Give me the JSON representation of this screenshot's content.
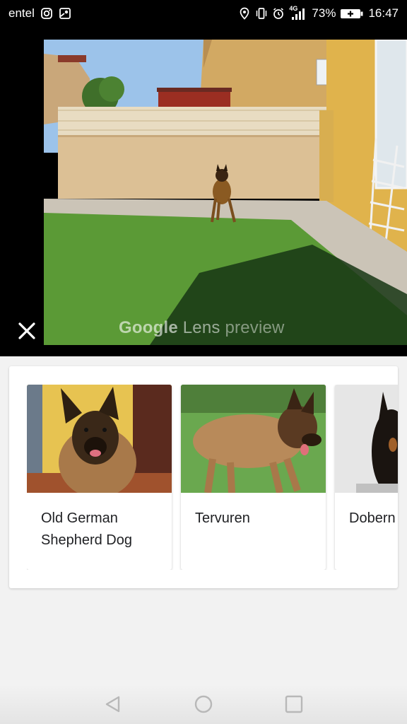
{
  "status_bar": {
    "carrier": "entel",
    "network": "4G",
    "battery_percent": "73%",
    "time": "16:47",
    "icons": [
      "instagram-icon",
      "maps-icon",
      "location-icon",
      "vibrate-icon",
      "alarm-icon",
      "signal-icon",
      "battery-icon"
    ]
  },
  "preview": {
    "brand": "Google",
    "lens_word": "Lens",
    "preview_word": "preview",
    "close_icon": "close-icon"
  },
  "results": [
    {
      "name": "Old German Shepherd Dog"
    },
    {
      "name": "Tervuren"
    },
    {
      "name": "Dobern"
    }
  ],
  "nav": {
    "back": "back-icon",
    "home": "home-icon",
    "recents": "recents-icon"
  },
  "colors": {
    "status_bar_bg": "#000000",
    "page_bg": "#f2f2f2",
    "card_bg": "#ffffff",
    "text": "#202124"
  }
}
